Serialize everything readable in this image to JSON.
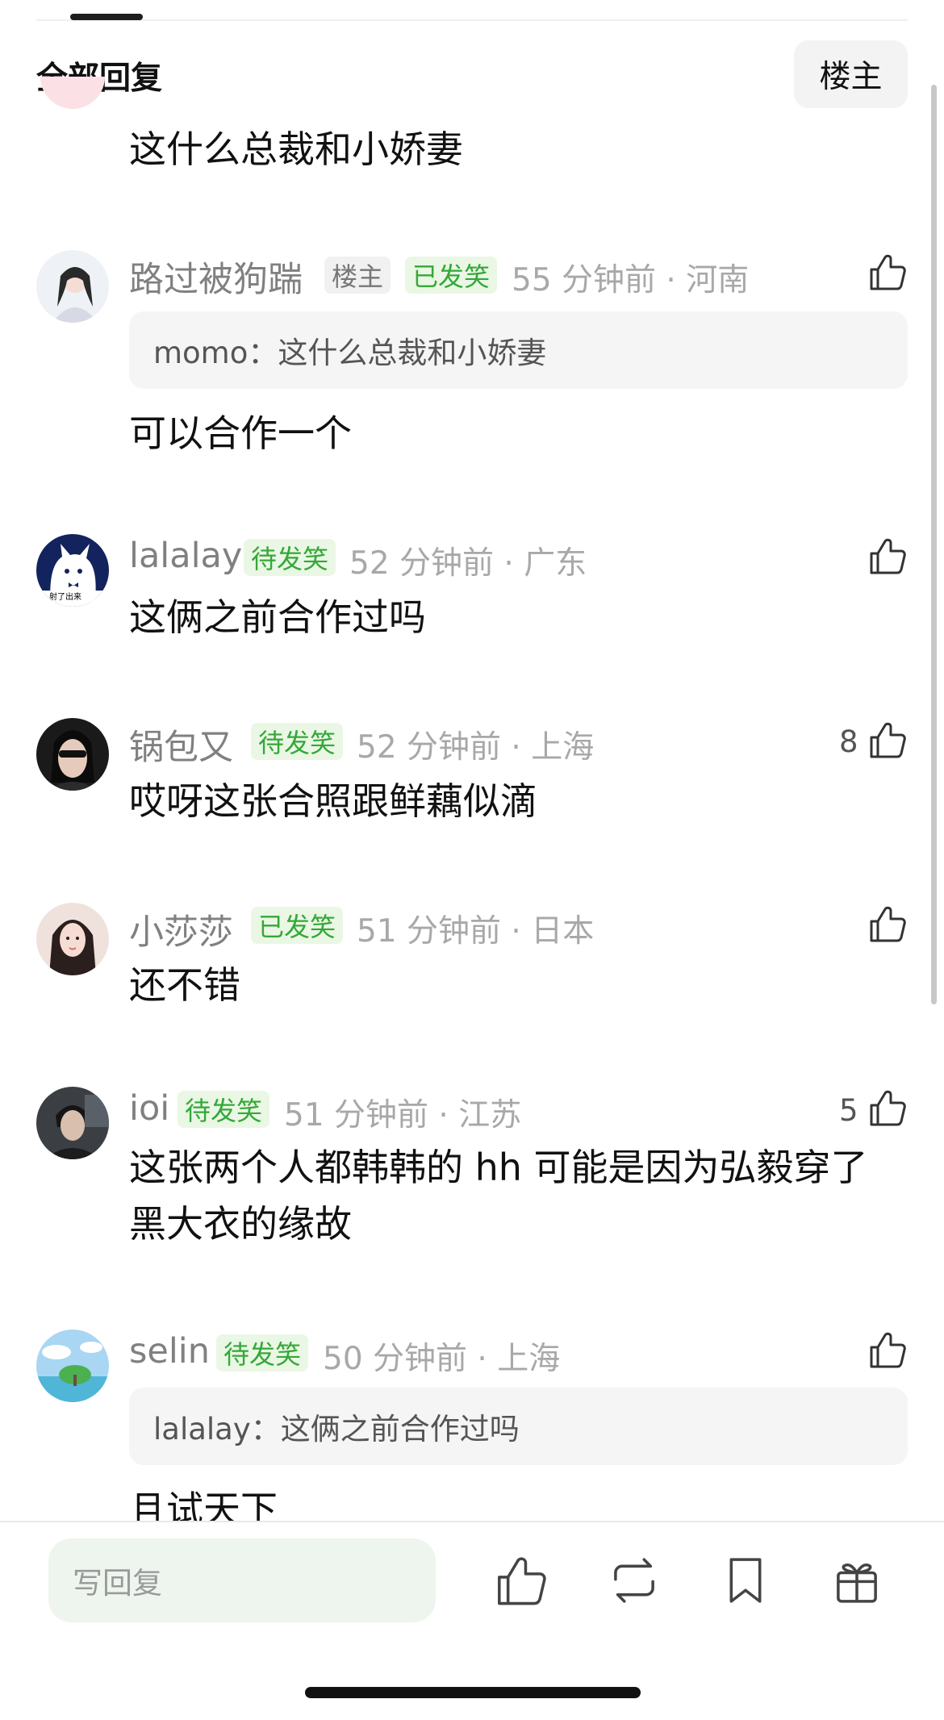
{
  "header": {
    "section_title": "全部回复",
    "op_filter_label": "楼主"
  },
  "comments": [
    {
      "text": "这什么总裁和小娇妻"
    },
    {
      "username": "路过被狗踹",
      "op_badge": "楼主",
      "status_badge": "已发笑",
      "meta": "55 分钟前 · 河南",
      "quote": "momo：这什么总裁和小娇妻",
      "text": "可以合作一个",
      "likes": ""
    },
    {
      "username": "lalalay",
      "status_badge": "待发笑",
      "meta": "52 分钟前 · 广东",
      "text": "这俩之前合作过吗",
      "likes": ""
    },
    {
      "username": "锅包又",
      "status_badge": "待发笑",
      "meta": "52 分钟前 · 上海",
      "text": "哎呀这张合照跟鲜藕似滴",
      "likes": "8"
    },
    {
      "username": "小莎莎",
      "status_badge": "已发笑",
      "meta": "51 分钟前 · 日本",
      "text": "还不错",
      "likes": ""
    },
    {
      "username": "ioi",
      "status_badge": "待发笑",
      "meta": "51 分钟前 · 江苏",
      "text": "这张两个人都韩韩的 hh 可能是因为弘毅穿了黑大衣的缘故",
      "likes": "5"
    },
    {
      "username": "selin",
      "status_badge": "待发笑",
      "meta": "50 分钟前 · 上海",
      "quote": "lalalay：这俩之前合作过吗",
      "text": "且试天下",
      "likes": ""
    }
  ],
  "bottom_bar": {
    "reply_placeholder": "写回复"
  },
  "colors": {
    "badge_green_text": "#34a839",
    "badge_green_bg": "#eaf7e4",
    "meta_gray": "#a8a8a8"
  }
}
